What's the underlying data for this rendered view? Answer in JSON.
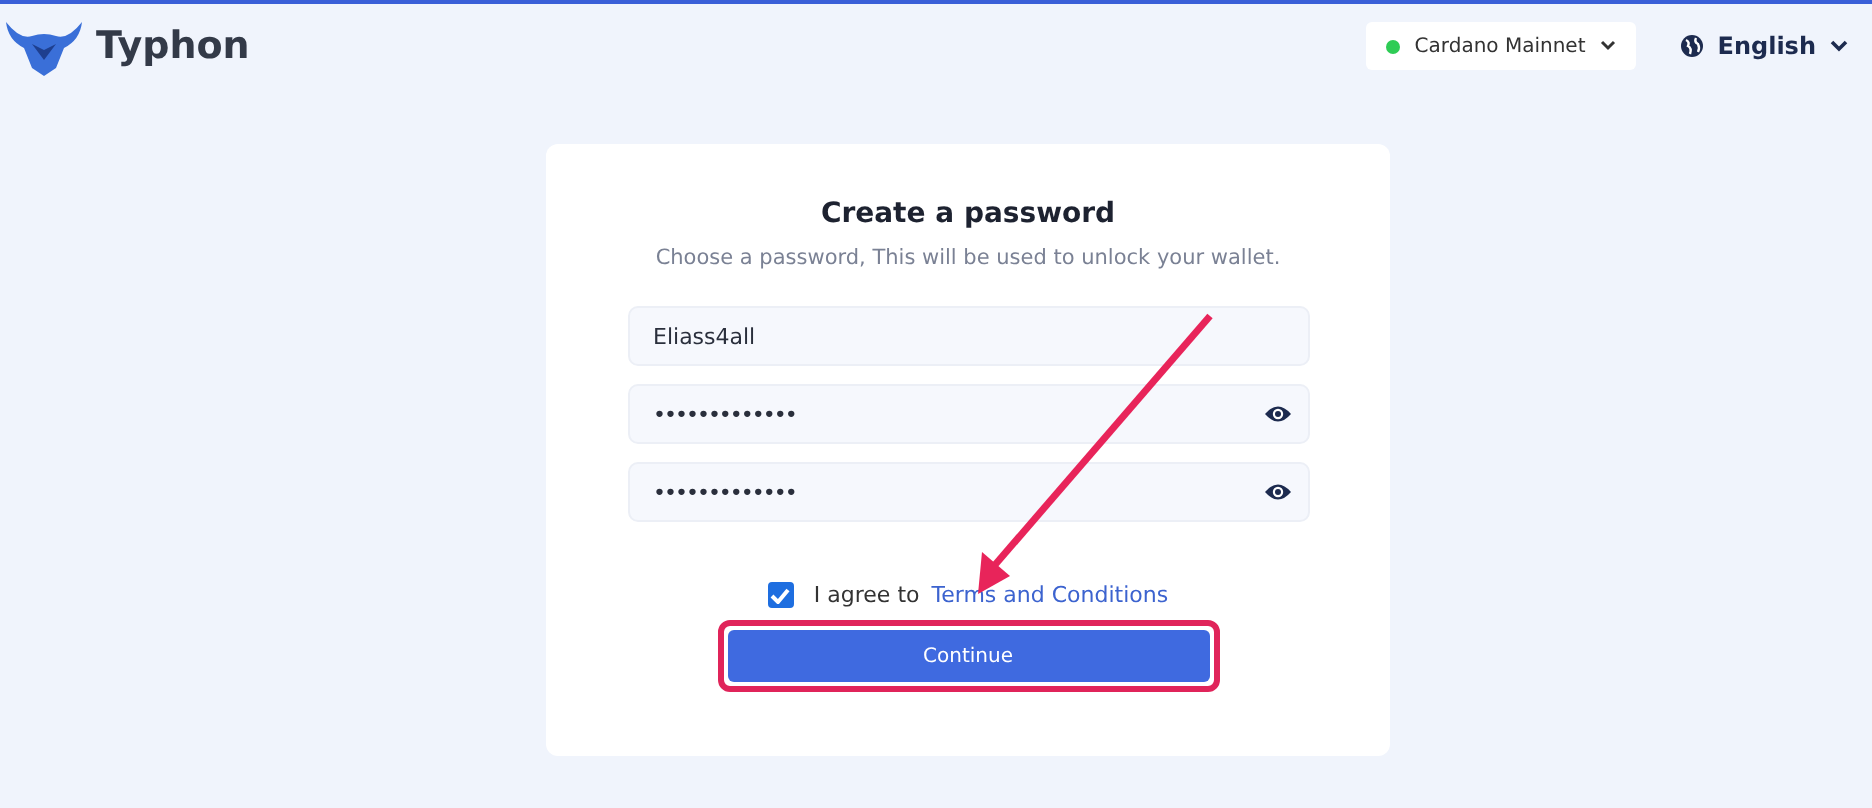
{
  "brand": {
    "name": "Typhon"
  },
  "network": {
    "label": "Cardano Mainnet",
    "color": "#2ecc55"
  },
  "language": {
    "label": "English"
  },
  "form": {
    "title": "Create a password",
    "subtitle": "Choose a password, This will be used to unlock your wallet.",
    "fields": [
      {
        "kind": "text",
        "value": "Eliass4all"
      },
      {
        "kind": "password",
        "value": "•••••••••••••"
      },
      {
        "kind": "password",
        "value": "•••••••••••••"
      }
    ],
    "agree": {
      "checked": true,
      "label": "I agree to",
      "link": "Terms and Conditions"
    },
    "button": "Continue"
  }
}
